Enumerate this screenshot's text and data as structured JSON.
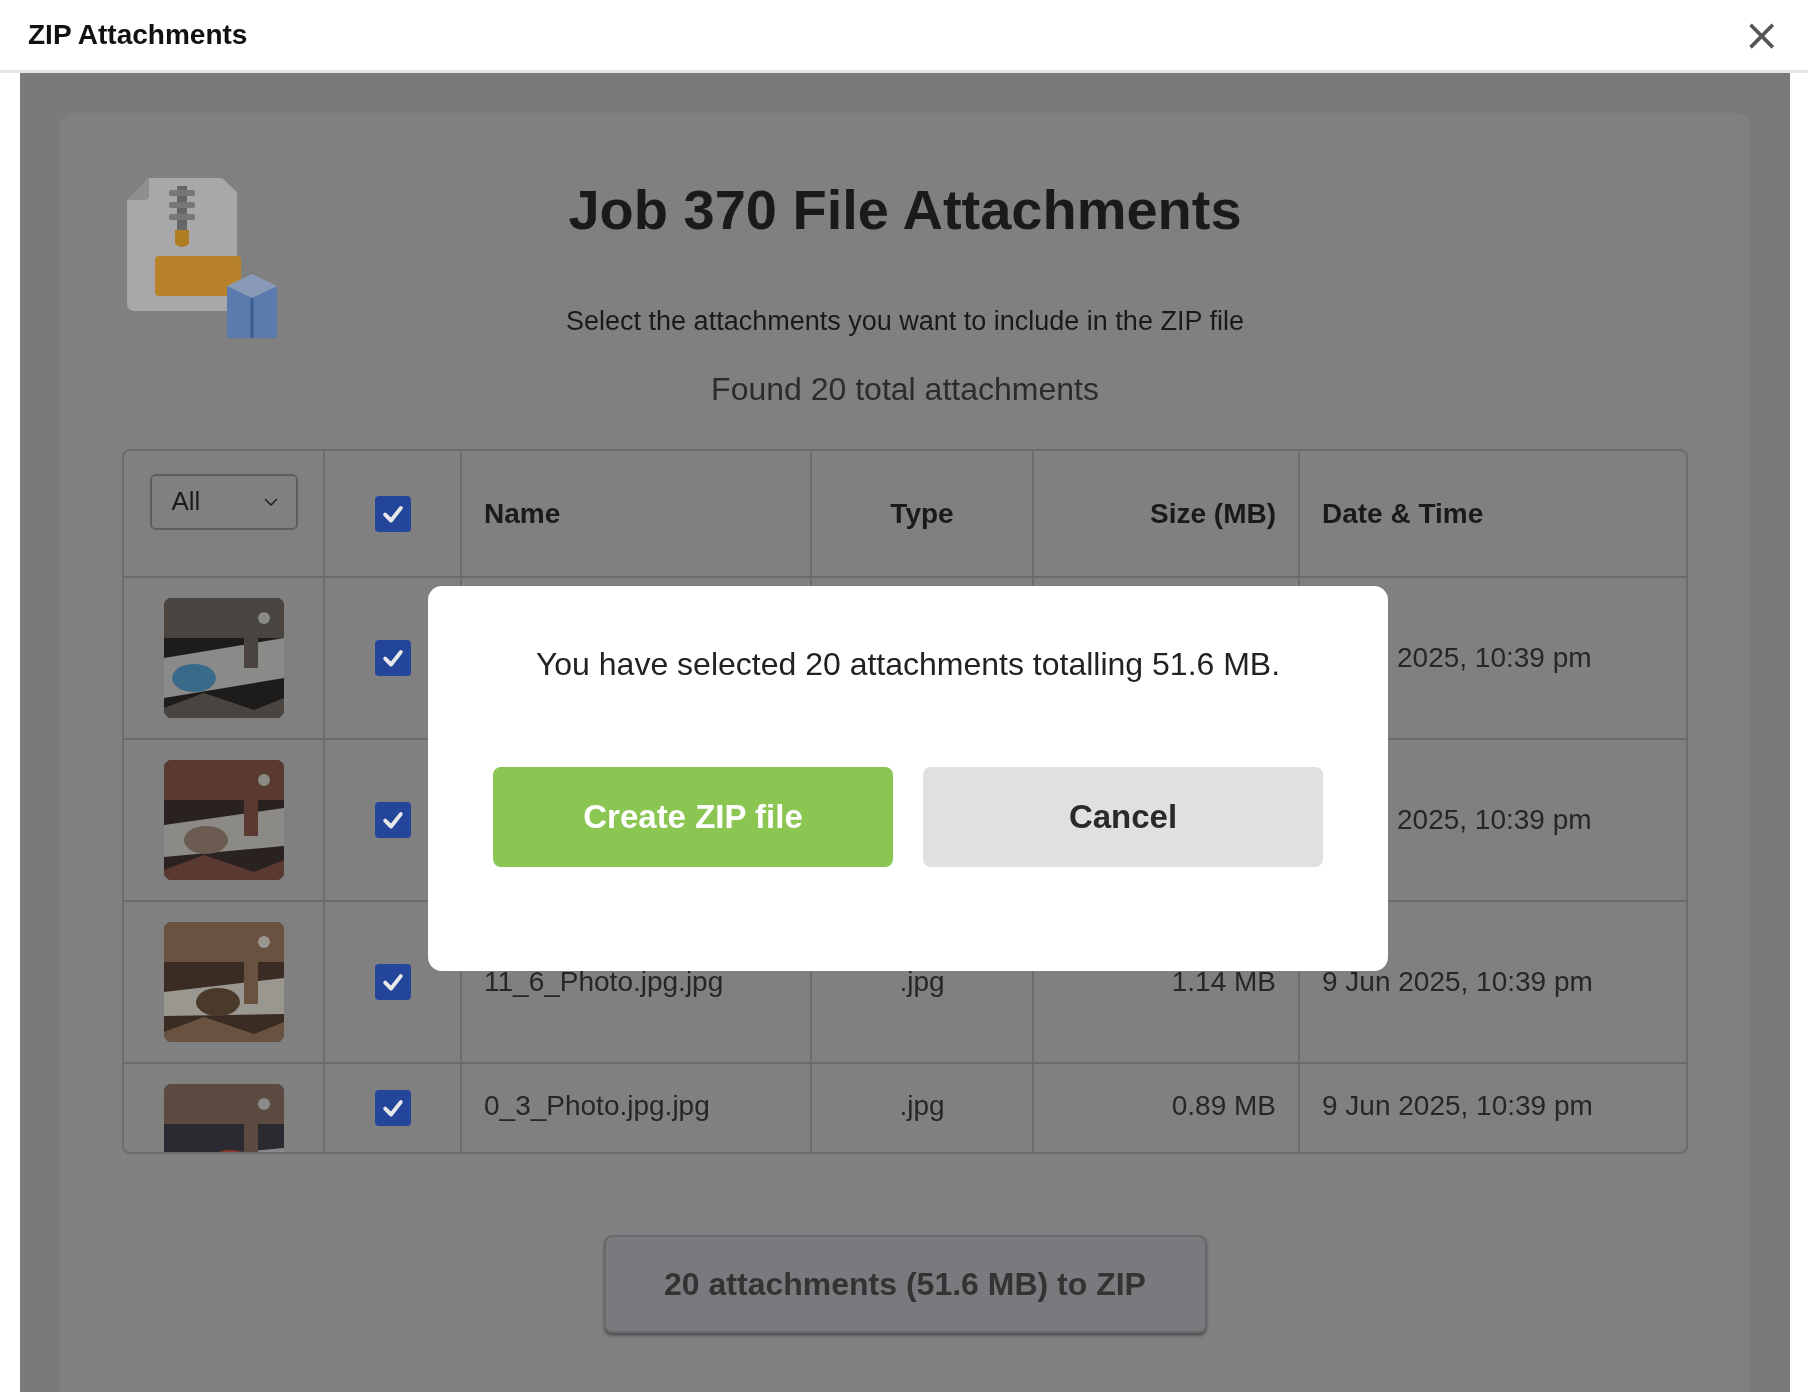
{
  "window": {
    "title": "ZIP Attachments",
    "close": "×"
  },
  "header": {
    "title": "Job 370 File Attachments",
    "subtitle": "Select the attachments you want to include in the ZIP file",
    "count": "Found 20 total attachments"
  },
  "table": {
    "filter": {
      "value": "All"
    },
    "all_checked": true,
    "columns": [
      "Name",
      "Type",
      "Size (MB)",
      "Date & Time"
    ],
    "rows": [
      {
        "checked": true,
        "date": "2025, 10:39 pm"
      },
      {
        "checked": true,
        "date": "2025, 10:39 pm"
      },
      {
        "checked": true,
        "name": "11_6_Photo.jpg.jpg",
        "type": ".jpg",
        "size": "1.14 MB",
        "date": "9 Jun 2025, 10:39 pm"
      },
      {
        "checked": true,
        "name": "0_3_Photo.jpg.jpg",
        "type": ".jpg",
        "size": "0.89 MB",
        "date": "9 Jun 2025, 10:39 pm"
      }
    ]
  },
  "zip_button": "20 attachments (51.6 MB) to ZIP",
  "dialog": {
    "message": "You have selected 20 attachments totalling 51.6 MB.",
    "buttons": [
      {
        "label": "Create ZIP file",
        "kind": "primary"
      },
      {
        "label": "Cancel",
        "kind": "secondary"
      }
    ]
  }
}
